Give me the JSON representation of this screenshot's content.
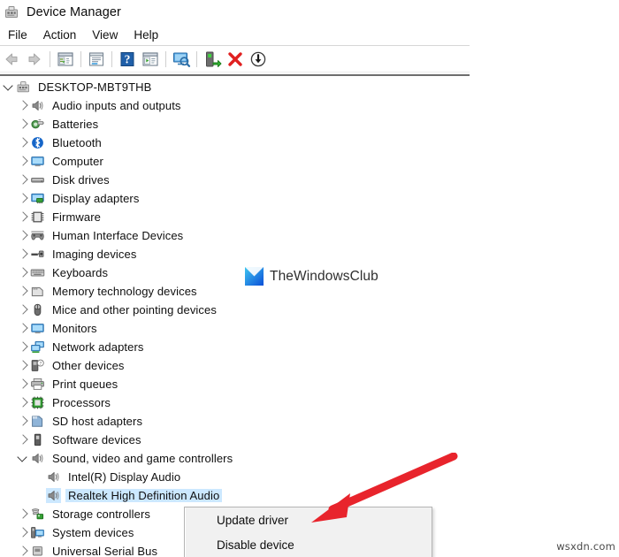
{
  "window": {
    "title": "Device Manager",
    "title_icon": "device-manager-icon"
  },
  "menubar": {
    "items": [
      {
        "label": "File",
        "name": "menu-file"
      },
      {
        "label": "Action",
        "name": "menu-action"
      },
      {
        "label": "View",
        "name": "menu-view"
      },
      {
        "label": "Help",
        "name": "menu-help"
      }
    ]
  },
  "toolbar": {
    "buttons": [
      {
        "icon": "back-arrow-icon",
        "enabled": false
      },
      {
        "icon": "forward-arrow-icon",
        "enabled": false
      },
      {
        "icon": "show-hide-console-tree-icon",
        "enabled": true
      },
      {
        "icon": "properties-icon",
        "enabled": true
      },
      {
        "icon": "help-icon",
        "enabled": true
      },
      {
        "icon": "scan-for-hardware-changes-icon",
        "enabled": true
      },
      {
        "icon": "update-driver-icon",
        "enabled": true
      },
      {
        "icon": "enable-device-icon",
        "enabled": true
      },
      {
        "icon": "uninstall-device-icon",
        "enabled": true
      },
      {
        "icon": "disable-device-icon",
        "enabled": true
      }
    ]
  },
  "tree": {
    "root": {
      "label": "DESKTOP-MBT9THB",
      "icon": "computer-root-icon",
      "expanded": true
    },
    "categories": [
      {
        "label": "Audio inputs and outputs",
        "icon": "speaker-icon",
        "expanded": false
      },
      {
        "label": "Batteries",
        "icon": "battery-icon",
        "expanded": false
      },
      {
        "label": "Bluetooth",
        "icon": "bluetooth-icon",
        "expanded": false
      },
      {
        "label": "Computer",
        "icon": "monitor-icon",
        "expanded": false
      },
      {
        "label": "Disk drives",
        "icon": "disk-drive-icon",
        "expanded": false
      },
      {
        "label": "Display adapters",
        "icon": "display-adapter-icon",
        "expanded": false
      },
      {
        "label": "Firmware",
        "icon": "firmware-chip-icon",
        "expanded": false
      },
      {
        "label": "Human Interface Devices",
        "icon": "gamepad-icon",
        "expanded": false
      },
      {
        "label": "Imaging devices",
        "icon": "scanner-icon",
        "expanded": false
      },
      {
        "label": "Keyboards",
        "icon": "keyboard-icon",
        "expanded": false
      },
      {
        "label": "Memory technology devices",
        "icon": "memory-card-icon",
        "expanded": false
      },
      {
        "label": "Mice and other pointing devices",
        "icon": "mouse-icon",
        "expanded": false
      },
      {
        "label": "Monitors",
        "icon": "monitor-icon",
        "expanded": false
      },
      {
        "label": "Network adapters",
        "icon": "network-adapter-icon",
        "expanded": false
      },
      {
        "label": "Other devices",
        "icon": "unknown-device-icon",
        "expanded": false
      },
      {
        "label": "Print queues",
        "icon": "printer-icon",
        "expanded": false
      },
      {
        "label": "Processors",
        "icon": "processor-icon",
        "expanded": false
      },
      {
        "label": "SD host adapters",
        "icon": "sd-host-icon",
        "expanded": false
      },
      {
        "label": "Software devices",
        "icon": "software-device-icon",
        "expanded": false
      },
      {
        "label": "Sound, video and game controllers",
        "icon": "speaker-icon",
        "expanded": true
      }
    ],
    "sound_children": [
      {
        "label": "Intel(R) Display Audio",
        "icon": "speaker-icon",
        "selected": false
      },
      {
        "label": "Realtek High Definition Audio",
        "icon": "speaker-icon",
        "selected": true
      }
    ],
    "categories_after": [
      {
        "label": "Storage controllers",
        "icon": "storage-controller-icon",
        "expanded": false
      },
      {
        "label": "System devices",
        "icon": "system-device-icon",
        "expanded": false
      },
      {
        "label": "Universal Serial Bus",
        "icon": "usb-icon",
        "expanded": false
      }
    ]
  },
  "context_menu": {
    "items": [
      {
        "label": "Update driver",
        "name": "ctx-update-driver"
      },
      {
        "label": "Disable device",
        "name": "ctx-disable-device"
      }
    ]
  },
  "annotations": {
    "arrow_color": "#E8242C",
    "arrow_target": "Update driver"
  },
  "watermark": {
    "text": "TheWindowsClub",
    "logo_colors": [
      "#3ec6f0",
      "#0b4fd8"
    ]
  },
  "credit": {
    "text": "wsxdn.com"
  },
  "colors": {
    "selection": "#cce8ff",
    "menu_bg": "#f1f1f1",
    "text": "#0f0f0f"
  }
}
